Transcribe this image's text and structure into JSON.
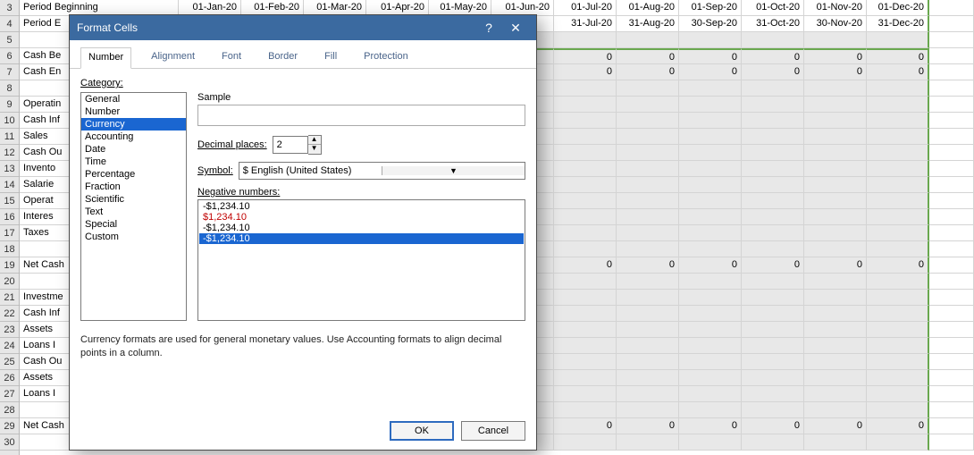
{
  "row_headers": [
    "3",
    "4",
    "5",
    "6",
    "7",
    "8",
    "9",
    "10",
    "11",
    "12",
    "13",
    "14",
    "15",
    "16",
    "17",
    "18",
    "19",
    "20",
    "21",
    "22",
    "23",
    "24",
    "25",
    "26",
    "27",
    "28",
    "29",
    "30"
  ],
  "labels": {
    "r3": "Period Beginning",
    "r4": "Period E",
    "r6": "Cash Be",
    "r7": "Cash En",
    "r9": "Operatin",
    "r10": "Cash Inf",
    "r11": "  Sales",
    "r12": "Cash Ou",
    "r13": "  Invento",
    "r14": "  Salarie",
    "r15": "  Operat",
    "r16": "  Interes",
    "r17": "  Taxes",
    "r19": "Net Cash",
    "r21": "Investme",
    "r22": "Cash Inf",
    "r23": "  Assets",
    "r24": "  Loans I",
    "r25": "Cash Ou",
    "r26": "  Assets",
    "r27": "  Loans I",
    "r29": "Net Cash"
  },
  "months_hdr_begin": [
    "01-Jan-20",
    "01-Feb-20",
    "01-Mar-20",
    "01-Apr-20",
    "01-May-20",
    "01-Jun-20",
    "01-Jul-20",
    "01-Aug-20",
    "01-Sep-20",
    "01-Oct-20",
    "01-Nov-20",
    "01-Dec-20"
  ],
  "months_hdr_end": [
    "",
    "",
    "",
    "",
    "",
    "",
    "31-Jul-20",
    "31-Aug-20",
    "30-Sep-20",
    "31-Oct-20",
    "30-Nov-20",
    "31-Dec-20"
  ],
  "zero_rows": [
    "r6",
    "r7",
    "r19",
    "r29"
  ],
  "dialog": {
    "title": "Format Cells",
    "tabs": [
      "Number",
      "Alignment",
      "Font",
      "Border",
      "Fill",
      "Protection"
    ],
    "active_tab": 0,
    "category_label": "Category:",
    "categories": [
      "General",
      "Number",
      "Currency",
      "Accounting",
      "Date",
      "Time",
      "Percentage",
      "Fraction",
      "Scientific",
      "Text",
      "Special",
      "Custom"
    ],
    "category_selected": 2,
    "sample_label": "Sample",
    "decimal_label": "Decimal places:",
    "decimal_value": "2",
    "symbol_label": "Symbol:",
    "symbol_value": "$ English (United States)",
    "neg_label": "Negative numbers:",
    "neg_options": [
      {
        "text": "-$1,234.10",
        "class": ""
      },
      {
        "text": "$1,234.10",
        "class": "red"
      },
      {
        "text": "-$1,234.10",
        "class": ""
      },
      {
        "text": "-$1,234.10",
        "class": "sel"
      }
    ],
    "hint": "Currency formats are used for general monetary values.  Use Accounting formats to align decimal points in a column.",
    "ok": "OK",
    "cancel": "Cancel"
  }
}
